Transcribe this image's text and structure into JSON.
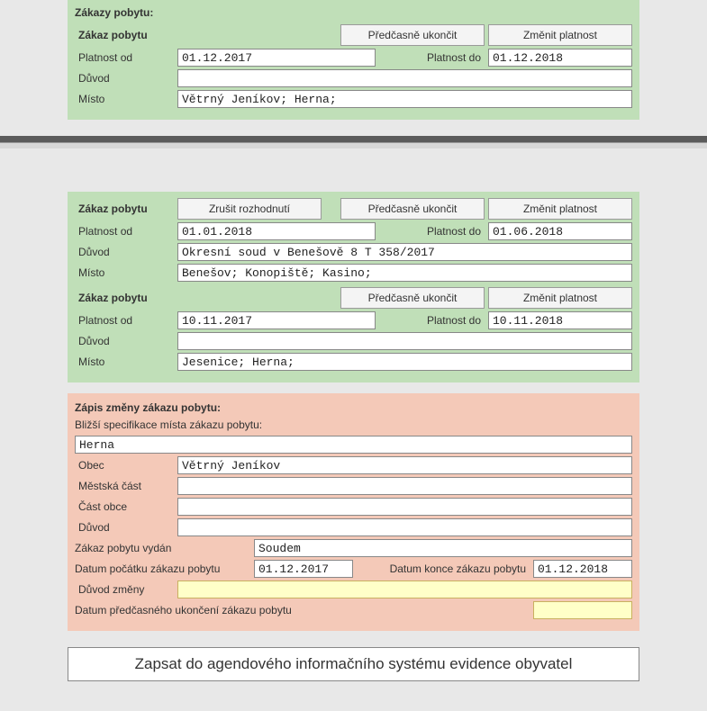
{
  "panel1": {
    "title": "Zákazy pobytu:",
    "item": {
      "heading": "Zákaz pobytu",
      "btn_end": "Předčasně ukončit",
      "btn_change": "Změnit platnost",
      "lbl_from": "Platnost od",
      "val_from": "01.12.2017",
      "lbl_to": "Platnost do",
      "val_to": "01.12.2018",
      "lbl_reason": "Důvod",
      "val_reason": "",
      "lbl_place": "Místo",
      "val_place": "Větrný Jeníkov; Herna;"
    }
  },
  "panel2": {
    "item1": {
      "heading": "Zákaz pobytu",
      "btn_cancel": "Zrušit rozhodnutí",
      "btn_end": "Předčasně ukončit",
      "btn_change": "Změnit platnost",
      "lbl_from": "Platnost od",
      "val_from": "01.01.2018",
      "lbl_to": "Platnost do",
      "val_to": "01.06.2018",
      "lbl_reason": "Důvod",
      "val_reason": "Okresní soud v Benešově 8 T 358/2017",
      "lbl_place": "Místo",
      "val_place": "Benešov; Konopiště; Kasino;"
    },
    "item2": {
      "heading": "Zákaz pobytu",
      "btn_end": "Předčasně ukončit",
      "btn_change": "Změnit platnost",
      "lbl_from": "Platnost od",
      "val_from": "10.11.2017",
      "lbl_to": "Platnost do",
      "val_to": "10.11.2018",
      "lbl_reason": "Důvod",
      "val_reason": "",
      "lbl_place": "Místo",
      "val_place": "Jesenice; Herna;"
    }
  },
  "pink": {
    "title": "Zápis změny zákazu pobytu:",
    "subtitle": "Bližší specifikace místa zákazu pobytu:",
    "spec": "Herna",
    "lbl_obec": "Obec",
    "val_obec": "Větrný Jeníkov",
    "lbl_mestska": "Městská část",
    "val_mestska": "",
    "lbl_castobce": "Část obce",
    "val_castobce": "",
    "lbl_duvod": "Důvod",
    "val_duvod": "",
    "lbl_vydan": "Zákaz pobytu vydán",
    "val_vydan": "Soudem",
    "lbl_start": "Datum počátku zákazu pobytu",
    "val_start": "01.12.2017",
    "lbl_end": "Datum konce zákazu pobytu",
    "val_end": "01.12.2018",
    "lbl_change_reason": "Důvod změny",
    "val_change_reason": "",
    "lbl_early_end": "Datum předčasného ukončení zákazu pobytu",
    "val_early_end": ""
  },
  "submit_label": "Zapsat do agendového informačního systému evidence obyvatel"
}
